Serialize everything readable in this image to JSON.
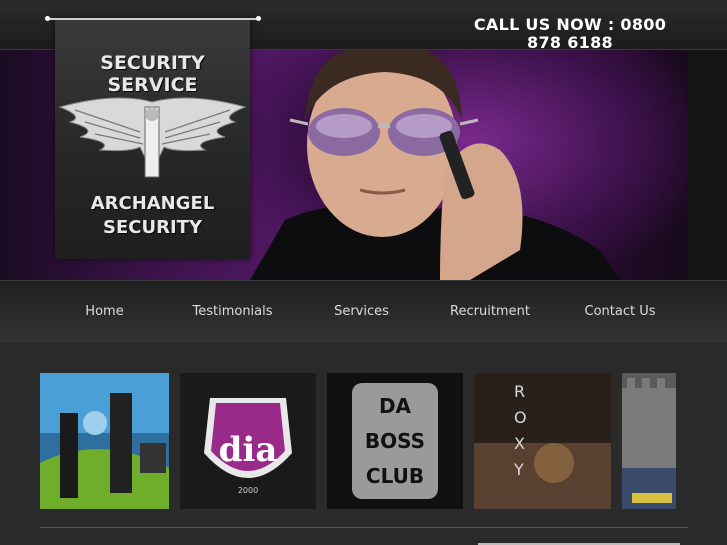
{
  "header": {
    "phone": "CALL US NOW : 0800 878 6188"
  },
  "logo": {
    "top_text": "SECURITY SERVICE",
    "bottom_text": "ARCHANGEL SECURITY"
  },
  "nav": {
    "items": [
      {
        "label": "Home"
      },
      {
        "label": "Testimonials"
      },
      {
        "label": "Services"
      },
      {
        "label": "Recruitment"
      },
      {
        "label": "Contact Us"
      }
    ]
  },
  "gallery": {
    "thumbs": [
      {
        "name": "club-interior"
      },
      {
        "name": "dia-logo",
        "text": "dia",
        "subtext": "2000"
      },
      {
        "name": "da-boss-club",
        "text_lines": [
          "DA",
          "BOSS",
          "CLUB"
        ]
      },
      {
        "name": "roxy",
        "text": "ROXY"
      },
      {
        "name": "castle"
      }
    ]
  },
  "colors": {
    "background": "#2a2a2a",
    "banner_purple": "#5a1a6e",
    "text": "#ffffff"
  }
}
